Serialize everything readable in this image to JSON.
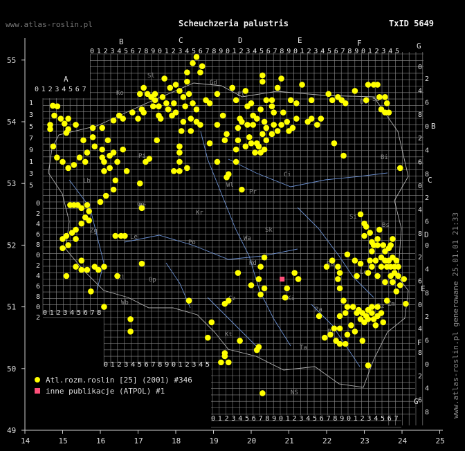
{
  "header": {
    "site": "www.atlas-roslin.pl",
    "title": "Scheuchzeria palustris",
    "taxid": "TxID 5649"
  },
  "side_text": "www.atlas-roslin.pl generowane 25.01.01 21:33",
  "legend": [
    {
      "label": "Atl.rozm.roslin [25] (2001) #346",
      "marker": "circle",
      "color": "#ffff00"
    },
    {
      "label": "inne publikacje (ATPOL) #1",
      "marker": "square",
      "color": "#ff4f7a"
    }
  ],
  "map": {
    "lon_ticks": [
      "14",
      "15",
      "16",
      "17",
      "18",
      "19",
      "20",
      "21",
      "22",
      "23",
      "24",
      "25"
    ],
    "lat_ticks": [
      "49",
      "50",
      "51",
      "52",
      "53",
      "54",
      "55"
    ],
    "square_letters_top": [
      "A",
      "B",
      "C",
      "D",
      "E",
      "F",
      "G"
    ],
    "square_letters_right": [
      "B",
      "C",
      "D",
      "E",
      "F",
      "G"
    ],
    "region_labels": [
      "Sl",
      "Gd",
      "El",
      "Ko",
      "Ol",
      "Su",
      "Bi",
      "Pi",
      "Ci",
      "Wl",
      "Pr",
      "By",
      "Go",
      "Kr",
      "Sk",
      "Wa",
      "Zg",
      "Le",
      "Po",
      "Lo",
      "Si",
      "Bs",
      "Lu",
      "Ra",
      "Ki",
      "Op",
      "Kl",
      "Wb",
      "Cz",
      "Rz",
      "Kt",
      "Ta",
      "NS",
      "Zm",
      "Pa",
      "Rd",
      "Pl",
      "Lb"
    ],
    "grid_row_numbers": "0123456789",
    "colors": {
      "background": "#000000",
      "grid": "#8a8a8a",
      "occurrence": "#ffff00",
      "atpol": "#ff4f7a"
    }
  },
  "occurrences": [
    [
      14.74,
      54.26
    ],
    [
      14.86,
      54.25
    ],
    [
      14.78,
      54.1
    ],
    [
      14.67,
      53.95
    ],
    [
      14.67,
      53.88
    ],
    [
      14.95,
      54.05
    ],
    [
      15.05,
      53.97
    ],
    [
      15.15,
      54.05
    ],
    [
      15.15,
      53.88
    ],
    [
      15.1,
      53.82
    ],
    [
      15.35,
      53.95
    ],
    [
      15.55,
      53.7
    ],
    [
      15.8,
      53.9
    ],
    [
      15.8,
      53.75
    ],
    [
      14.75,
      53.6
    ],
    [
      14.85,
      53.42
    ],
    [
      15.0,
      53.35
    ],
    [
      15.15,
      53.25
    ],
    [
      15.3,
      53.3
    ],
    [
      15.45,
      53.42
    ],
    [
      15.6,
      53.35
    ],
    [
      15.65,
      53.5
    ],
    [
      15.85,
      53.6
    ],
    [
      16.05,
      53.55
    ],
    [
      16.05,
      53.42
    ],
    [
      16.1,
      53.35
    ],
    [
      16.25,
      53.45
    ],
    [
      16.35,
      53.5
    ],
    [
      16.45,
      53.35
    ],
    [
      16.6,
      53.55
    ],
    [
      16.7,
      53.2
    ],
    [
      16.1,
      53.2
    ],
    [
      16.25,
      53.25
    ],
    [
      16.4,
      53.05
    ],
    [
      16.35,
      52.9
    ],
    [
      16.15,
      52.8
    ],
    [
      16.0,
      52.7
    ],
    [
      15.2,
      52.65
    ],
    [
      15.3,
      52.65
    ],
    [
      15.4,
      52.65
    ],
    [
      15.5,
      52.6
    ],
    [
      15.65,
      52.65
    ],
    [
      15.7,
      52.55
    ],
    [
      15.6,
      52.45
    ],
    [
      15.7,
      52.4
    ],
    [
      15.5,
      52.35
    ],
    [
      15.35,
      52.25
    ],
    [
      15.25,
      52.2
    ],
    [
      15.1,
      52.15
    ],
    [
      15.0,
      52.1
    ],
    [
      15.15,
      52.0
    ],
    [
      15.0,
      51.95
    ],
    [
      15.35,
      52.1
    ],
    [
      15.5,
      51.75
    ],
    [
      15.35,
      51.65
    ],
    [
      15.1,
      51.5
    ],
    [
      15.5,
      51.6
    ],
    [
      15.65,
      51.6
    ],
    [
      15.85,
      51.65
    ],
    [
      15.95,
      51.6
    ],
    [
      16.1,
      51.65
    ],
    [
      16.45,
      51.5
    ],
    [
      15.75,
      51.25
    ],
    [
      16.1,
      51.0
    ],
    [
      16.4,
      52.15
    ],
    [
      16.55,
      52.15
    ],
    [
      16.65,
      52.15
    ],
    [
      17.1,
      52.6
    ],
    [
      17.1,
      51.7
    ],
    [
      17.05,
      53.0
    ],
    [
      17.2,
      53.35
    ],
    [
      17.3,
      53.4
    ],
    [
      17.5,
      53.7
    ],
    [
      17.55,
      54.1
    ],
    [
      17.4,
      54.25
    ],
    [
      17.25,
      54.45
    ],
    [
      17.15,
      54.55
    ],
    [
      17.05,
      54.45
    ],
    [
      17.1,
      54.2
    ],
    [
      16.85,
      54.15
    ],
    [
      16.5,
      54.1
    ],
    [
      16.6,
      54.05
    ],
    [
      16.35,
      54.02
    ],
    [
      16.05,
      53.9
    ],
    [
      16.2,
      53.7
    ],
    [
      17.0,
      54.05
    ],
    [
      17.15,
      54.15
    ],
    [
      17.35,
      54.4
    ],
    [
      17.45,
      54.45
    ],
    [
      17.45,
      54.35
    ],
    [
      17.55,
      54.25
    ],
    [
      17.6,
      54.05
    ],
    [
      17.65,
      54.4
    ],
    [
      17.75,
      54.3
    ],
    [
      17.8,
      54.2
    ],
    [
      17.9,
      54.1
    ],
    [
      17.95,
      54.3
    ],
    [
      18.0,
      54.15
    ],
    [
      17.7,
      54.7
    ],
    [
      17.85,
      54.55
    ],
    [
      18.0,
      54.6
    ],
    [
      18.1,
      54.5
    ],
    [
      18.2,
      54.4
    ],
    [
      18.25,
      54.25
    ],
    [
      18.3,
      54.65
    ],
    [
      18.3,
      54.8
    ],
    [
      18.45,
      54.95
    ],
    [
      18.55,
      55.05
    ],
    [
      18.7,
      54.9
    ],
    [
      18.65,
      54.8
    ],
    [
      18.35,
      54.45
    ],
    [
      18.45,
      54.3
    ],
    [
      18.55,
      54.2
    ],
    [
      18.4,
      54.05
    ],
    [
      18.2,
      54.0
    ],
    [
      18.55,
      54.0
    ],
    [
      18.65,
      53.95
    ],
    [
      18.4,
      53.85
    ],
    [
      18.8,
      54.35
    ],
    [
      18.9,
      54.3
    ],
    [
      19.1,
      54.45
    ],
    [
      19.25,
      54.1
    ],
    [
      19.1,
      53.95
    ],
    [
      18.9,
      53.65
    ],
    [
      18.15,
      53.85
    ],
    [
      18.1,
      53.6
    ],
    [
      18.1,
      53.5
    ],
    [
      18.1,
      53.35
    ],
    [
      18.3,
      53.25
    ],
    [
      18.1,
      53.2
    ],
    [
      17.95,
      53.2
    ],
    [
      19.1,
      53.35
    ],
    [
      19.3,
      53.7
    ],
    [
      19.35,
      53.8
    ],
    [
      19.4,
      53.15
    ],
    [
      19.6,
      53.35
    ],
    [
      19.35,
      53.1
    ],
    [
      19.75,
      52.9
    ],
    [
      19.9,
      54.25
    ],
    [
      20.05,
      54.1
    ],
    [
      20.15,
      54.05
    ],
    [
      20.25,
      54.2
    ],
    [
      20.35,
      54.0
    ],
    [
      20.4,
      53.9
    ],
    [
      20.3,
      53.8
    ],
    [
      20.15,
      53.65
    ],
    [
      20.2,
      53.6
    ],
    [
      20.1,
      53.5
    ],
    [
      20.25,
      53.5
    ],
    [
      20.35,
      53.55
    ],
    [
      20.4,
      53.7
    ],
    [
      20.55,
      53.8
    ],
    [
      20.6,
      53.95
    ],
    [
      20.7,
      53.85
    ],
    [
      20.8,
      53.95
    ],
    [
      20.85,
      54.15
    ],
    [
      20.95,
      54.0
    ],
    [
      21.0,
      53.85
    ],
    [
      21.1,
      53.9
    ],
    [
      21.2,
      54.05
    ],
    [
      20.6,
      54.15
    ],
    [
      20.55,
      54.25
    ],
    [
      20.4,
      54.35
    ],
    [
      20.3,
      54.65
    ],
    [
      20.3,
      54.75
    ],
    [
      20.55,
      54.35
    ],
    [
      21.05,
      54.35
    ],
    [
      21.2,
      54.3
    ],
    [
      20.7,
      54.55
    ],
    [
      20.8,
      54.7
    ],
    [
      20.05,
      53.95
    ],
    [
      19.9,
      53.95
    ],
    [
      19.75,
      54.0
    ],
    [
      19.65,
      53.9
    ],
    [
      19.7,
      54.05
    ],
    [
      19.95,
      53.75
    ],
    [
      20.0,
      53.65
    ],
    [
      19.85,
      53.6
    ],
    [
      19.6,
      53.55
    ],
    [
      19.65,
      53.7
    ],
    [
      20.0,
      54.3
    ],
    [
      19.6,
      54.35
    ],
    [
      19.5,
      54.55
    ],
    [
      19.85,
      54.5
    ],
    [
      21.6,
      54.05
    ],
    [
      21.85,
      54.05
    ],
    [
      21.75,
      53.95
    ],
    [
      21.5,
      54.0
    ],
    [
      21.6,
      54.35
    ],
    [
      21.35,
      54.6
    ],
    [
      22.05,
      54.45
    ],
    [
      22.15,
      54.35
    ],
    [
      22.3,
      54.4
    ],
    [
      22.4,
      54.35
    ],
    [
      22.5,
      54.3
    ],
    [
      22.2,
      53.65
    ],
    [
      22.45,
      53.45
    ],
    [
      22.75,
      54.5
    ],
    [
      23.05,
      54.35
    ],
    [
      23.1,
      54.6
    ],
    [
      23.25,
      54.6
    ],
    [
      23.35,
      54.6
    ],
    [
      23.4,
      54.4
    ],
    [
      23.45,
      54.2
    ],
    [
      23.6,
      54.3
    ],
    [
      23.55,
      54.4
    ],
    [
      23.55,
      54.15
    ],
    [
      23.65,
      54.15
    ],
    [
      23.95,
      53.25
    ],
    [
      23.05,
      52.3
    ],
    [
      23.15,
      52.2
    ],
    [
      23.2,
      52.05
    ],
    [
      23.25,
      52.0
    ],
    [
      23.2,
      51.9
    ],
    [
      23.3,
      51.75
    ],
    [
      23.15,
      51.75
    ],
    [
      23.2,
      51.65
    ],
    [
      23.1,
      51.55
    ],
    [
      23.35,
      52.0
    ],
    [
      23.45,
      51.8
    ],
    [
      23.45,
      51.65
    ],
    [
      23.55,
      51.75
    ],
    [
      23.6,
      51.65
    ],
    [
      23.7,
      51.65
    ],
    [
      23.8,
      51.65
    ],
    [
      23.9,
      51.65
    ],
    [
      23.85,
      51.75
    ],
    [
      23.65,
      51.75
    ],
    [
      23.75,
      51.8
    ],
    [
      23.55,
      51.9
    ],
    [
      23.65,
      51.95
    ],
    [
      23.5,
      52.0
    ],
    [
      23.35,
      52.1
    ],
    [
      23.4,
      52.25
    ],
    [
      23.75,
      52.1
    ],
    [
      23.7,
      52.0
    ],
    [
      23.9,
      51.5
    ],
    [
      23.95,
      51.35
    ],
    [
      24.05,
      51.45
    ],
    [
      23.8,
      51.55
    ],
    [
      23.7,
      51.5
    ],
    [
      23.75,
      51.4
    ],
    [
      23.35,
      51.5
    ],
    [
      23.55,
      51.4
    ],
    [
      23.6,
      51.1
    ],
    [
      23.85,
      51.25
    ],
    [
      24.1,
      51.05
    ],
    [
      23.0,
      52.35
    ],
    [
      23.0,
      52.15
    ],
    [
      22.9,
      52.5
    ],
    [
      22.75,
      51.75
    ],
    [
      22.8,
      51.5
    ],
    [
      22.55,
      51.85
    ],
    [
      22.9,
      51.7
    ],
    [
      22.3,
      51.65
    ],
    [
      22.15,
      51.75
    ],
    [
      22.0,
      51.65
    ],
    [
      22.35,
      51.55
    ],
    [
      22.3,
      51.45
    ],
    [
      22.35,
      51.3
    ],
    [
      22.45,
      51.1
    ],
    [
      22.55,
      51.0
    ],
    [
      22.5,
      50.9
    ],
    [
      22.35,
      50.85
    ],
    [
      22.7,
      51.0
    ],
    [
      22.85,
      50.95
    ],
    [
      22.95,
      50.9
    ],
    [
      23.05,
      50.85
    ],
    [
      23.1,
      50.95
    ],
    [
      23.2,
      50.9
    ],
    [
      23.25,
      50.8
    ],
    [
      23.35,
      50.85
    ],
    [
      23.45,
      50.9
    ],
    [
      23.35,
      51.0
    ],
    [
      23.2,
      51.0
    ],
    [
      23.1,
      50.8
    ],
    [
      23.0,
      50.75
    ],
    [
      22.9,
      50.8
    ],
    [
      22.8,
      50.9
    ],
    [
      23.3,
      50.7
    ],
    [
      23.5,
      50.75
    ],
    [
      22.65,
      50.7
    ],
    [
      22.75,
      50.6
    ],
    [
      22.55,
      50.55
    ],
    [
      22.5,
      50.4
    ],
    [
      22.35,
      50.4
    ],
    [
      22.25,
      50.45
    ],
    [
      22.1,
      50.55
    ],
    [
      22.2,
      50.65
    ],
    [
      21.8,
      50.85
    ],
    [
      21.95,
      50.5
    ],
    [
      22.35,
      50.65
    ],
    [
      22.95,
      50.45
    ],
    [
      23.1,
      50.05
    ],
    [
      21.25,
      51.45
    ],
    [
      21.15,
      51.55
    ],
    [
      20.35,
      51.8
    ],
    [
      20.25,
      51.65
    ],
    [
      20.2,
      51.45
    ],
    [
      20.35,
      51.3
    ],
    [
      20.25,
      51.2
    ],
    [
      20.0,
      51.35
    ],
    [
      19.65,
      51.55
    ],
    [
      19.4,
      51.1
    ],
    [
      19.3,
      51.05
    ],
    [
      18.35,
      51.1
    ],
    [
      18.95,
      50.75
    ],
    [
      18.85,
      50.5
    ],
    [
      19.3,
      50.25
    ],
    [
      19.3,
      50.2
    ],
    [
      19.2,
      50.1
    ],
    [
      19.4,
      50.1
    ],
    [
      19.7,
      50.45
    ],
    [
      20.15,
      50.3
    ],
    [
      20.2,
      50.35
    ],
    [
      20.3,
      49.6
    ],
    [
      20.9,
      51.15
    ],
    [
      20.95,
      51.3
    ],
    [
      16.8,
      50.8
    ],
    [
      16.8,
      50.6
    ]
  ],
  "atpol_records": [
    [
      20.82,
      51.45
    ]
  ]
}
